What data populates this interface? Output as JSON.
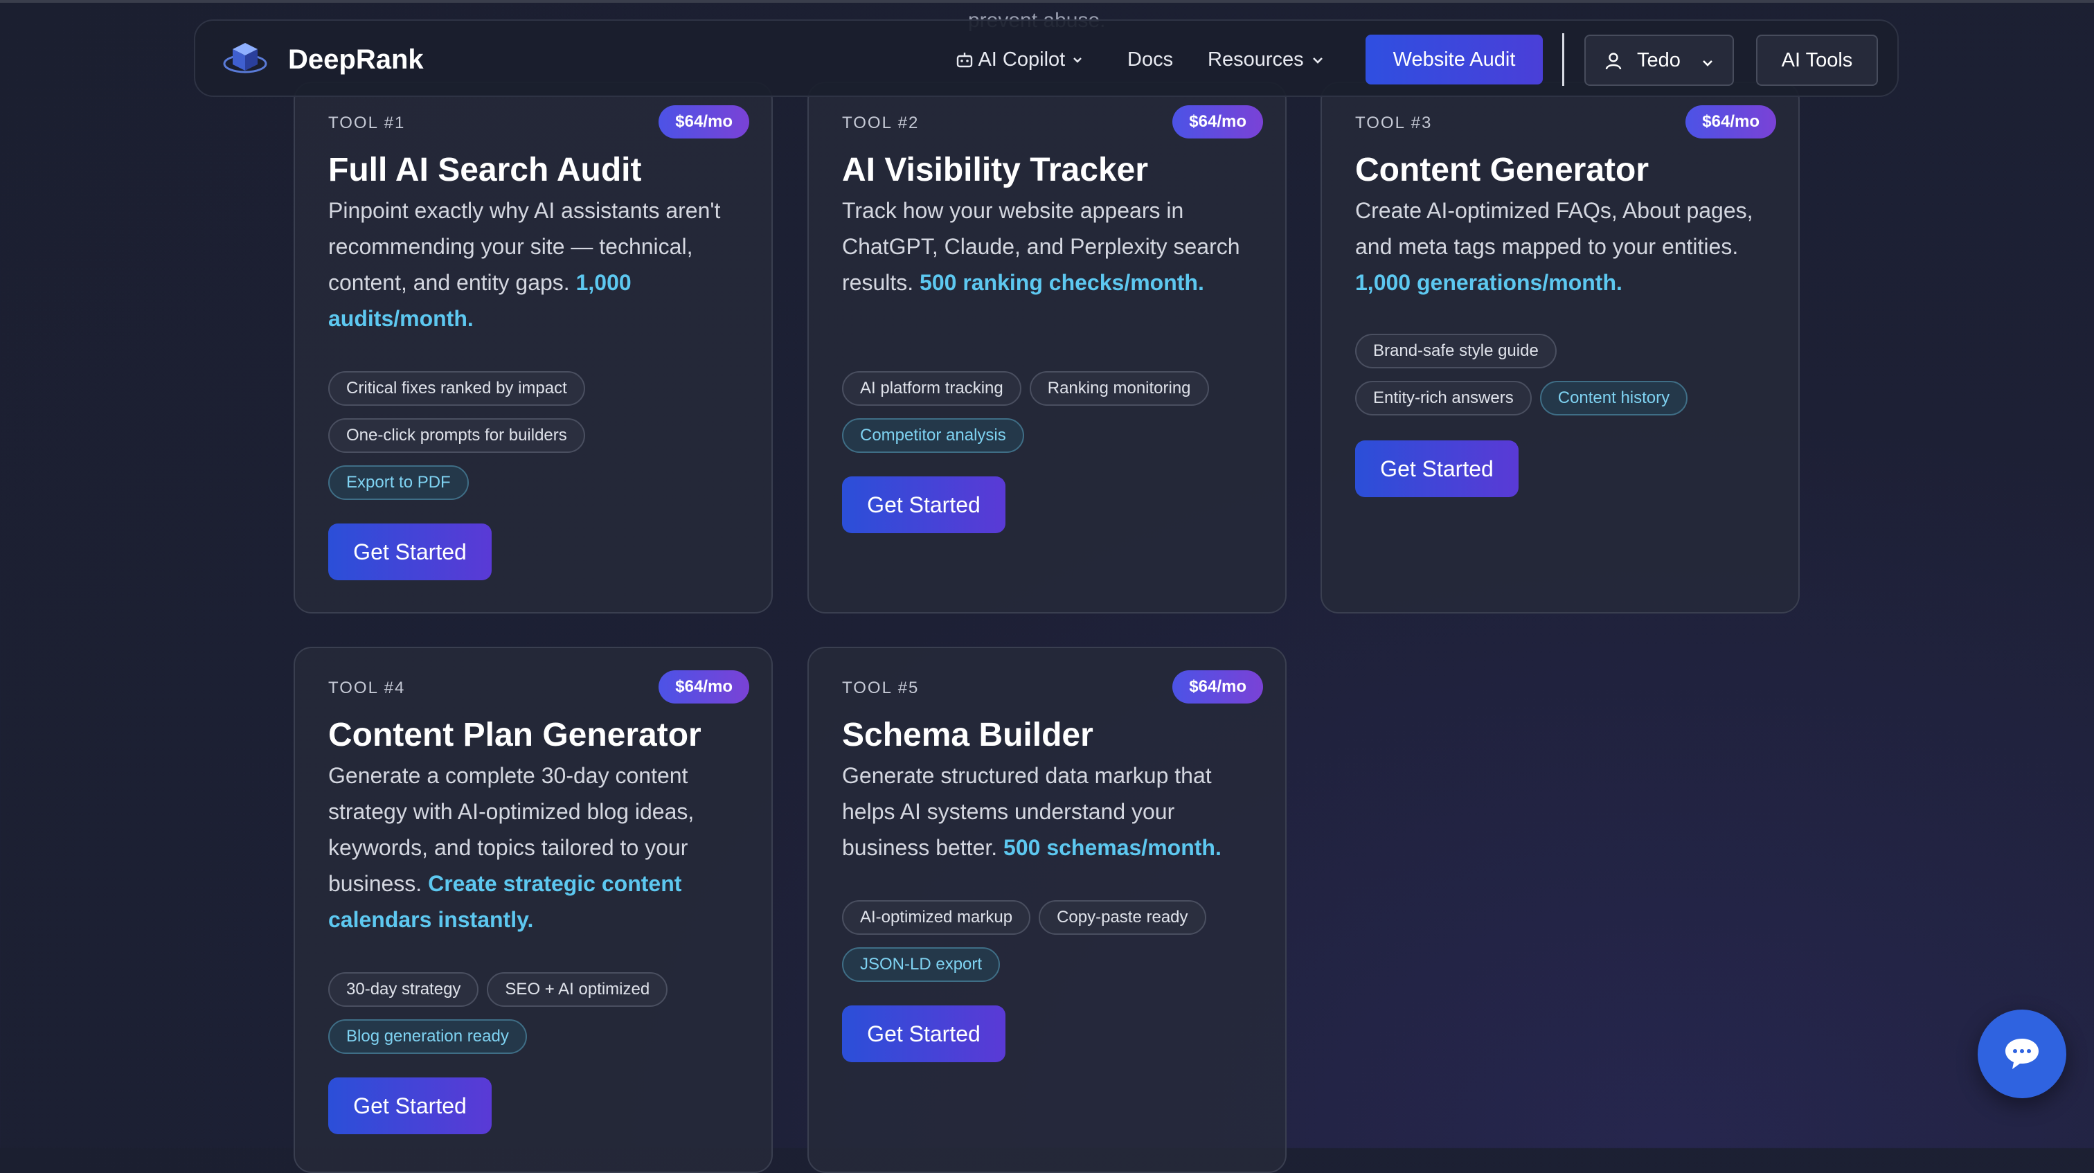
{
  "overlay_text": "prevent abuse.",
  "nav": {
    "brand": "DeepRank",
    "copilot_label": "AI Copilot",
    "docs_label": "Docs",
    "resources_label": "Resources",
    "audit_button": "Website Audit",
    "user_label": "Tedo",
    "tools_button": "AI Tools"
  },
  "cards": [
    {
      "number": "TOOL #1",
      "price": "$64/mo",
      "title": "Full AI Search Audit",
      "desc": "Pinpoint exactly why AI assistants aren't recommending your site — technical, content, and entity gaps.",
      "highlight": "1,000 audits/month.",
      "tags": [
        "Critical fixes ranked by impact",
        "One-click prompts for builders"
      ],
      "accent_tag": "Export to PDF",
      "cta": "Get Started"
    },
    {
      "number": "TOOL #2",
      "price": "$64/mo",
      "title": "AI Visibility Tracker",
      "desc": "Track how your website appears in ChatGPT, Claude, and Perplexity search results.",
      "highlight": "500 ranking checks/month.",
      "tags": [
        "AI platform tracking",
        "Ranking monitoring"
      ],
      "accent_tag": "Competitor analysis",
      "cta": "Get Started"
    },
    {
      "number": "TOOL #3",
      "price": "$64/mo",
      "title": "Content Generator",
      "desc": "Create AI-optimized FAQs, About pages, and meta tags mapped to your entities.",
      "highlight": "1,000 generations/month.",
      "tags": [
        "Brand-safe style guide",
        "Entity-rich answers"
      ],
      "accent_tag": "Content history",
      "cta": "Get Started"
    },
    {
      "number": "TOOL #4",
      "price": "$64/mo",
      "title": "Content Plan Generator",
      "desc": "Generate a complete 30-day content strategy with AI-optimized blog ideas, keywords, and topics tailored to your business.",
      "highlight": "Create strategic content calendars instantly.",
      "tags": [
        "30-day strategy",
        "SEO + AI optimized"
      ],
      "accent_tag": "Blog generation ready",
      "cta": "Get Started"
    },
    {
      "number": "TOOL #5",
      "price": "$64/mo",
      "title": "Schema Builder",
      "desc": "Generate structured data markup that helps AI systems understand your business better.",
      "highlight": "500 schemas/month.",
      "tags": [
        "AI-optimized markup",
        "Copy-paste ready"
      ],
      "accent_tag": "JSON-LD export",
      "cta": "Get Started"
    }
  ],
  "icons": {
    "logo": "cube-logo-icon",
    "copilot": "robot-icon",
    "user": "user-icon",
    "caret": "chevron-down-icon",
    "chat": "chat-bubble-icon"
  },
  "colors": {
    "accent_blue": "#2f4fe0",
    "highlight_cyan": "#5dc8f0",
    "price_gradient_start": "#4c53e6",
    "price_gradient_end": "#7a42d6",
    "chat_button": "#2f63e0"
  }
}
